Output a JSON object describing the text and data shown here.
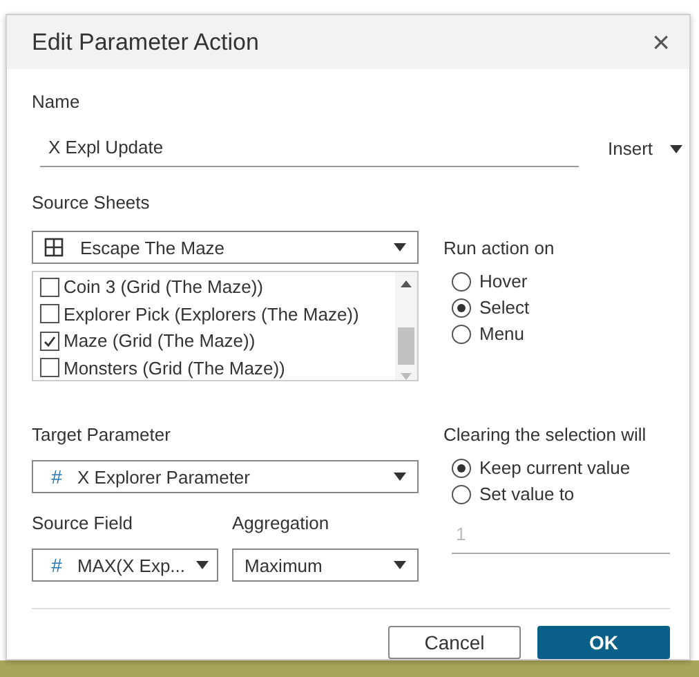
{
  "dialog": {
    "title": "Edit Parameter Action",
    "close": "×"
  },
  "name": {
    "label": "Name",
    "value": "X Expl Update",
    "insert": "Insert"
  },
  "source_sheets": {
    "label": "Source Sheets",
    "dashboard": "Escape The Maze",
    "sheets": [
      {
        "label": "Coin 3 (Grid (The Maze))",
        "checked": false
      },
      {
        "label": "Explorer Pick (Explorers (The Maze))",
        "checked": false
      },
      {
        "label": "Maze (Grid (The Maze))",
        "checked": true
      },
      {
        "label": "Monsters (Grid (The Maze))",
        "checked": false
      }
    ]
  },
  "run_action_on": {
    "label": "Run action on",
    "options": [
      {
        "label": "Hover",
        "selected": false
      },
      {
        "label": "Select",
        "selected": true
      },
      {
        "label": "Menu",
        "selected": false
      }
    ]
  },
  "target_parameter": {
    "label": "Target Parameter",
    "value": "X Explorer Parameter",
    "icon": "#"
  },
  "source_field": {
    "label": "Source Field",
    "value": "MAX(X Exp...",
    "icon": "#"
  },
  "aggregation": {
    "label": "Aggregation",
    "value": "Maximum"
  },
  "clearing": {
    "label": "Clearing the selection will",
    "options": [
      {
        "label": "Keep current value",
        "selected": true
      },
      {
        "label": "Set value to",
        "selected": false
      }
    ],
    "value": "1",
    "value_disabled": true
  },
  "buttons": [
    {
      "label": "Cancel",
      "kind": "secondary"
    },
    {
      "label": "OK",
      "kind": "primary"
    }
  ]
}
